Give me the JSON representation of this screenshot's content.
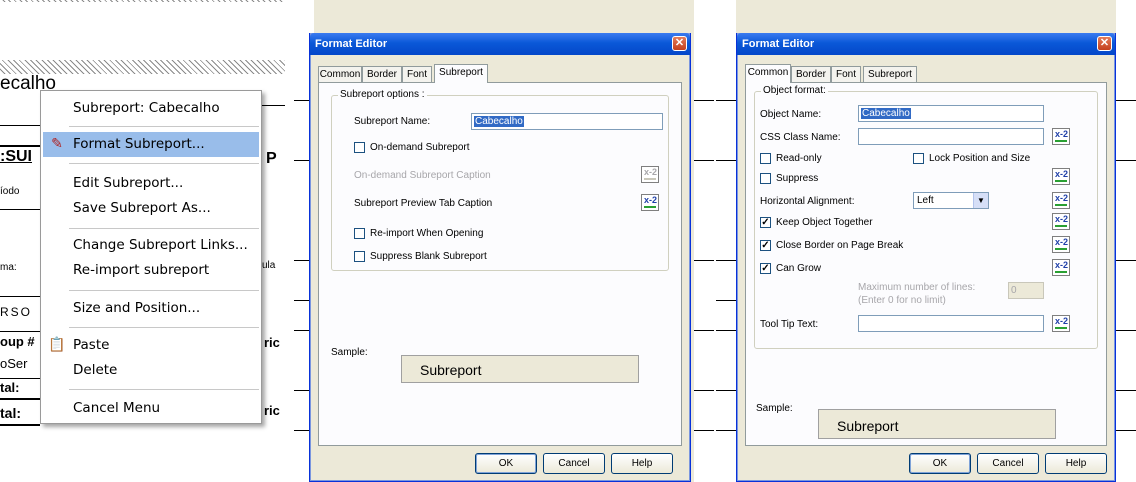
{
  "panel1": {
    "report_title": "ecalho",
    "report_labels": [
      ":SUI",
      "íodo",
      "ma:",
      "RSO",
      "oup #",
      "oSer",
      "tal:",
      "tal:"
    ],
    "report_right_labels": [
      "P",
      "ula",
      "ric",
      "ric"
    ],
    "context_menu": {
      "items": [
        {
          "label": "Subreport:  Cabecalho"
        },
        {
          "label": "Format Subreport..."
        },
        {
          "label": "Edit Subreport..."
        },
        {
          "label": "Save Subreport As..."
        },
        {
          "label": "Change Subreport Links..."
        },
        {
          "label": "Re-import subreport"
        },
        {
          "label": "Size and Position..."
        },
        {
          "label": "Paste"
        },
        {
          "label": "Delete"
        },
        {
          "label": "Cancel Menu"
        }
      ],
      "selected_index": 1
    }
  },
  "dialog1": {
    "title": "Format Editor",
    "tabs": [
      "Common",
      "Border",
      "Font",
      "Subreport"
    ],
    "active_tab": "Subreport",
    "group_label": "Subreport options :",
    "subreport_name_label": "Subreport Name:",
    "subreport_name_value": "Cabecalho",
    "on_demand_label": "On-demand Subreport",
    "on_demand_caption_label": "On-demand Subreport Caption",
    "preview_tab_caption_label": "Subreport Preview Tab Caption",
    "reimport_label": "Re-import When Opening",
    "suppress_blank_label": "Suppress Blank Subreport",
    "sample_label": "Sample:",
    "sample_text": "Subreport",
    "ok": "OK",
    "cancel": "Cancel",
    "help": "Help",
    "formula_icon": "x-2"
  },
  "dialog2": {
    "title": "Format Editor",
    "tabs": [
      "Common",
      "Border",
      "Font",
      "Subreport"
    ],
    "active_tab": "Common",
    "group_label": "Object format:",
    "object_name_label": "Object Name:",
    "object_name_value": "Cabecalho",
    "css_label": "CSS Class Name:",
    "css_value": "",
    "readonly_label": "Read-only",
    "lock_label": "Lock Position and Size",
    "suppress_label": "Suppress",
    "halign_label": "Horizontal Alignment:",
    "halign_value": "Left",
    "keep_together_label": "Keep Object Together",
    "close_border_label": "Close Border on Page Break",
    "can_grow_label": "Can Grow",
    "max_lines_label": "Maximum number of lines:",
    "max_lines_hint": "(Enter 0 for no limit)",
    "max_lines_value": "0",
    "tooltip_label": "Tool Tip Text:",
    "tooltip_value": "",
    "sample_label": "Sample:",
    "sample_text": "Subreport",
    "ok": "OK",
    "cancel": "Cancel",
    "help": "Help",
    "formula_icon": "x-2"
  },
  "colors": {
    "menu_highlight": "#99bdea",
    "title_bar": "#0a58d8",
    "dialog_bg": "#ece9d8",
    "text_selection": "#316ac5"
  }
}
